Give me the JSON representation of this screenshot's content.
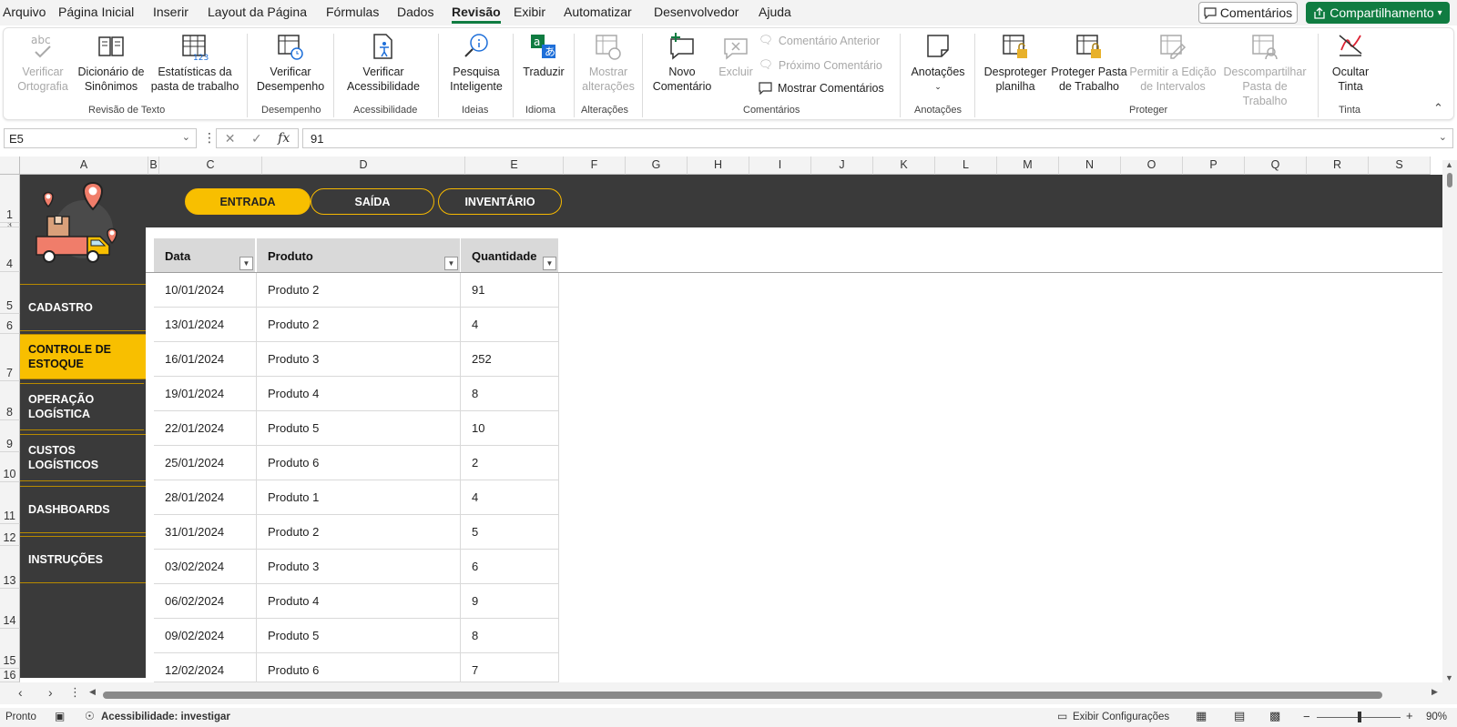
{
  "menu": {
    "tabs": [
      "Arquivo",
      "Página Inicial",
      "Inserir",
      "Layout da Página",
      "Fórmulas",
      "Dados",
      "Revisão",
      "Exibir",
      "Automatizar",
      "Desenvolvedor",
      "Ajuda"
    ],
    "active_tab": "Revisão",
    "comments_button": "Comentários",
    "share_button": "Compartilhamento"
  },
  "ribbon": {
    "buttons": {
      "verificar_ortografia": "Verificar Ortografia",
      "dicionario": "Dicionário de Sinônimos",
      "estatisticas": "Estatísticas da pasta de trabalho",
      "verificar_desempenho": "Verificar Desempenho",
      "verificar_acessibilidade": "Verificar Acessibilidade",
      "pesquisa_inteligente": "Pesquisa Inteligente",
      "traduzir": "Traduzir",
      "mostrar_alteracoes": "Mostrar alterações",
      "novo_comentario": "Novo Comentário",
      "excluir": "Excluir",
      "comentario_anterior": "Comentário Anterior",
      "proximo_comentario": "Próximo Comentário",
      "mostrar_comentarios": "Mostrar Comentários",
      "anotacoes": "Anotações",
      "desproteger_planilha": "Desproteger planilha",
      "proteger_pasta": "Proteger Pasta de Trabalho",
      "permitir_edicao": "Permitir a Edição de Intervalos",
      "descompartilhar": "Descompartilhar Pasta de Trabalho",
      "ocultar_tinta": "Ocultar Tinta"
    },
    "groups": {
      "revisao_texto": "Revisão de Texto",
      "desempenho": "Desempenho",
      "acessibilidade": "Acessibilidade",
      "ideias": "Ideias",
      "idioma": "Idioma",
      "alteracoes": "Alterações",
      "comentarios": "Comentários",
      "anotacoes": "Anotações",
      "proteger": "Proteger",
      "tinta": "Tinta"
    }
  },
  "formula_bar": {
    "name_box": "E5",
    "fx": "fx",
    "formula": "91"
  },
  "grid": {
    "columns": [
      "A",
      "B",
      "C",
      "D",
      "E",
      "F",
      "G",
      "H",
      "I",
      "J",
      "K",
      "L",
      "M",
      "N",
      "O",
      "P",
      "Q",
      "R",
      "S"
    ],
    "rows": [
      "1",
      "3",
      "4",
      "5",
      "6",
      "7",
      "8",
      "9",
      "10",
      "11",
      "12",
      "13",
      "14",
      "15",
      "16"
    ]
  },
  "dashboard": {
    "top_nav": [
      "ENTRADA",
      "SAÍDA",
      "INVENTÁRIO"
    ],
    "side_nav": [
      "CADASTRO",
      "CONTROLE DE ESTOQUE",
      "OPERAÇÃO LOGÍSTICA",
      "CUSTOS LOGÍSTICOS",
      "DASHBOARDS",
      "INSTRUÇÕES"
    ],
    "accent_color": "#f8bf00",
    "panel_color": "#3a3a3a"
  },
  "table": {
    "headers": [
      "Data",
      "Produto",
      "Quantidade"
    ],
    "rows": [
      [
        "10/01/2024",
        "Produto 2",
        "91"
      ],
      [
        "13/01/2024",
        "Produto 2",
        "4"
      ],
      [
        "16/01/2024",
        "Produto 3",
        "252"
      ],
      [
        "19/01/2024",
        "Produto 4",
        "8"
      ],
      [
        "22/01/2024",
        "Produto 5",
        "10"
      ],
      [
        "25/01/2024",
        "Produto 6",
        "2"
      ],
      [
        "28/01/2024",
        "Produto 1",
        "4"
      ],
      [
        "31/01/2024",
        "Produto 2",
        "5"
      ],
      [
        "03/02/2024",
        "Produto 3",
        "6"
      ],
      [
        "06/02/2024",
        "Produto 4",
        "9"
      ],
      [
        "09/02/2024",
        "Produto 5",
        "8"
      ],
      [
        "12/02/2024",
        "Produto 6",
        "7"
      ]
    ]
  },
  "status_bar": {
    "ready": "Pronto",
    "accessibility": "Acessibilidade: investigar",
    "display_settings": "Exibir Configurações",
    "zoom": "90%"
  }
}
